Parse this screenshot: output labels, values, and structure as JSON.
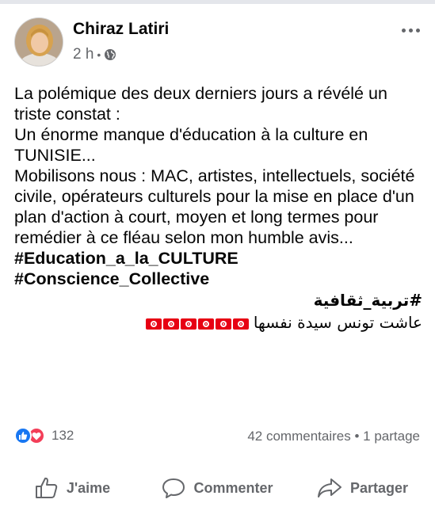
{
  "post": {
    "author": "Chiraz Latiri",
    "time": "2 h",
    "separator": "•",
    "privacy_icon": "globe-icon",
    "paragraphs": [
      "La polémique des deux derniers jours a révélé un triste constat  :",
      "Un énorme manque  d'éducation à la culture  en TUNISIE...",
      "Mobilisons nous : MAC, artistes, intellectuels, société civile, opérateurs culturels pour la mise en place d'un plan d'action à court, moyen et long termes pour remédier à ce fléau selon mon humble avis..."
    ],
    "hashtags": [
      "#Education_a_la_CULTURE",
      "#Conscience_Collective"
    ],
    "arabic_hashtag": "#تربية_ثقافية",
    "arabic_line": "عاشت تونس سيدة نفسها",
    "flag_count": 6
  },
  "stats": {
    "reaction_icons": [
      "like-icon",
      "love-icon"
    ],
    "reactions_count": "132",
    "comments": "42 commentaires",
    "dot": "•",
    "shares": "1 partage"
  },
  "actions": {
    "like": "J'aime",
    "comment": "Commenter",
    "share": "Partager"
  },
  "colors": {
    "like_blue": "#1877f2",
    "love_red": "#f33e58",
    "tunisia_red": "#e70013",
    "secondary_text": "#65676b"
  }
}
